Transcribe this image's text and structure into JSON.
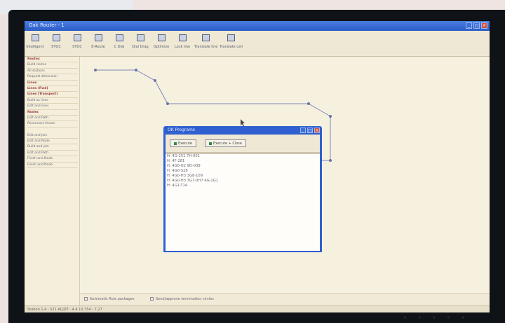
{
  "window": {
    "title": "Oak Router - 1"
  },
  "toolbar": {
    "tools": [
      {
        "label": "Intelligent"
      },
      {
        "label": "STOC"
      },
      {
        "label": "STOC"
      },
      {
        "label": "E-Route"
      },
      {
        "label": "C Dial"
      },
      {
        "label": "Dial Drag"
      },
      {
        "label": "Optimize"
      },
      {
        "label": "Lock line"
      },
      {
        "label": "Translate line"
      },
      {
        "label": "Translate cell"
      }
    ]
  },
  "sidebar": {
    "items": [
      {
        "label": "Routes",
        "header": true
      },
      {
        "label": "Build routes",
        "header": false
      },
      {
        "label": "All stations",
        "header": false
      },
      {
        "label": "Request dimension",
        "header": false
      },
      {
        "label": "Lines",
        "header": true
      },
      {
        "label": "Lines (Fwd)",
        "header": true
      },
      {
        "label": "Lines (Transport)",
        "header": true
      },
      {
        "label": "Build as lines",
        "header": false
      },
      {
        "label": "Edit and lines",
        "header": false
      },
      {
        "label": "Nodes",
        "header": true
      },
      {
        "label": "Edit and Path",
        "header": false
      },
      {
        "label": "Reconnect shown",
        "header": false
      }
    ],
    "items2": [
      {
        "label": "Edit and Join"
      },
      {
        "label": "Edit and Node"
      },
      {
        "label": "Build and join"
      },
      {
        "label": "Edit and Path"
      },
      {
        "label": "Finish and Node"
      },
      {
        "label": "Finish and Node"
      }
    ]
  },
  "dialog": {
    "title": "OK Programs",
    "btn_execute": "Execute",
    "btn_execute_close": "Execute + Close",
    "lines": [
      "H: 4G-251 7H-001",
      "H: 4F-281",
      "H: 4G0-H2 9D-009",
      "H: 4G0-S28",
      "H: 4G0-H3 3G8-109",
      "H: 4G0-H3 3G7-0H7 4G-2G1",
      "H: 4G1-T14"
    ]
  },
  "options": {
    "opt1": "Automatic Rule packages",
    "opt2": "Send/approve termination circles"
  },
  "statusbar": {
    "text": "Station 1.4 - 521 ACJDT - 4.4 10.754 - 7.27"
  },
  "colors": {
    "accent": "#2f5fd0",
    "canvas_bg": "#f6f1df",
    "route_line": "#7d86b8"
  },
  "icons": [
    "tool-icon",
    "close-icon",
    "minimize-icon",
    "maximize-icon",
    "cursor-icon"
  ]
}
